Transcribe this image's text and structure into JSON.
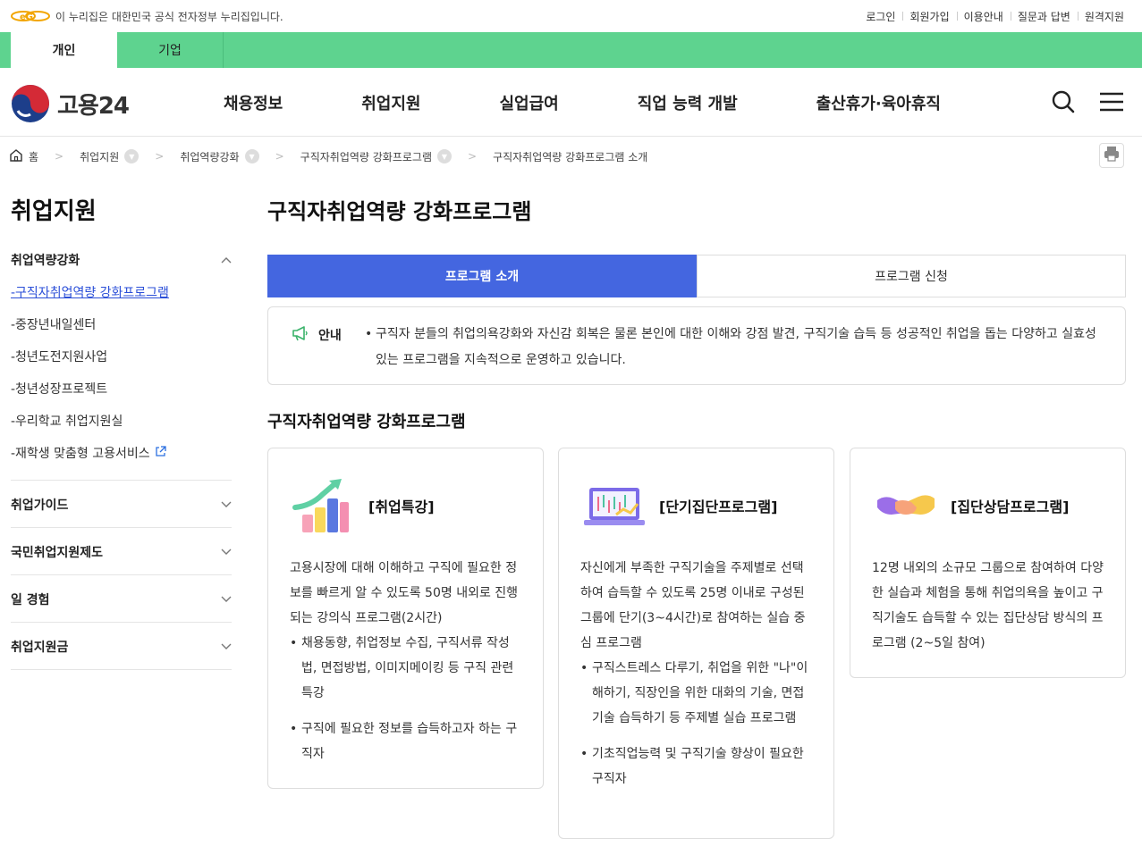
{
  "gov_banner": {
    "notice": "이 누리집은 대한민국 공식 전자정부 누리집입니다.",
    "links": [
      "로그인",
      "회원가입",
      "이용안내",
      "질문과 답변",
      "원격지원"
    ]
  },
  "user_tabs": [
    "개인",
    "기업"
  ],
  "header": {
    "logo_text": "고용24",
    "gnb": [
      "채용정보",
      "취업지원",
      "실업급여",
      "직업 능력 개발",
      "출산휴가·육아휴직"
    ]
  },
  "breadcrumb": [
    "홈",
    "취업지원",
    "취업역량강화",
    "구직자취업역량 강화프로그램",
    "구직자취업역량 강화프로그램 소개"
  ],
  "sidebar": {
    "title": "취업지원",
    "groups": [
      {
        "label": "취업역량강화",
        "items": [
          "-구직자취업역량 강화프로그램",
          "-중장년내일센터",
          "-청년도전지원사업",
          "-청년성장프로젝트",
          "-우리학교 취업지원실",
          "-재학생 맞춤형 고용서비스"
        ]
      },
      {
        "label": "취업가이드"
      },
      {
        "label": "국민취업지원제도"
      },
      {
        "label": "일 경험"
      },
      {
        "label": "취업지원금"
      }
    ]
  },
  "main": {
    "title": "구직자취업역량 강화프로그램",
    "tabs": [
      "프로그램 소개",
      "프로그램 신청"
    ],
    "notice_label": "안내",
    "notice_text": "구직자 분들의 취업의욕강화와 자신감 회복은 물론 본인에 대한 이해와 강점 발견, 구직기술 습득 등 성공적인 취업을 돕는 다양하고 실효성 있는 프로그램을 지속적으로 운영하고 있습니다.",
    "section_title": "구직자취업역량 강화프로그램",
    "cards": [
      {
        "title": "[취업특강]",
        "desc": "고용시장에 대해 이해하고 구직에 필요한 정보를 빠르게 알 수 있도록 50명 내외로 진행되는 강의식 프로그램(2시간)",
        "bullets": [
          "채용동향, 취업정보 수집, 구직서류 작성법, 면접방법, 이미지메이킹 등 구직 관련 특강",
          "구직에 필요한 정보를 습득하고자 하는 구직자"
        ]
      },
      {
        "title": "[단기집단프로그램]",
        "desc": "자신에게 부족한 구직기술을 주제별로 선택하여 습득할 수 있도록 25명 이내로 구성된 그룹에 단기(3~4시간)로 참여하는 실습 중심 프로그램",
        "bullets": [
          "구직스트레스 다루기, 취업을 위한 \"나\"이해하기, 직장인을 위한 대화의 기술, 면접기술 습득하기 등 주제별 실습 프로그램",
          "기초직업능력 및 구직기술 향상이 필요한 구직자"
        ]
      },
      {
        "title": "[집단상담프로그램]",
        "desc": "12명 내외의 소규모 그룹으로 참여하여 다양한 실습과 체험을 통해 취업의욕을 높이고 구직기술도 습득할 수 있는 집단상담 방식의 프로그램 (2~5일 참여)",
        "bullets": []
      }
    ]
  },
  "colors": {
    "green_bar": "#5ed38f",
    "tab_active": "#4466e0",
    "link_active": "#2b4fd8"
  }
}
